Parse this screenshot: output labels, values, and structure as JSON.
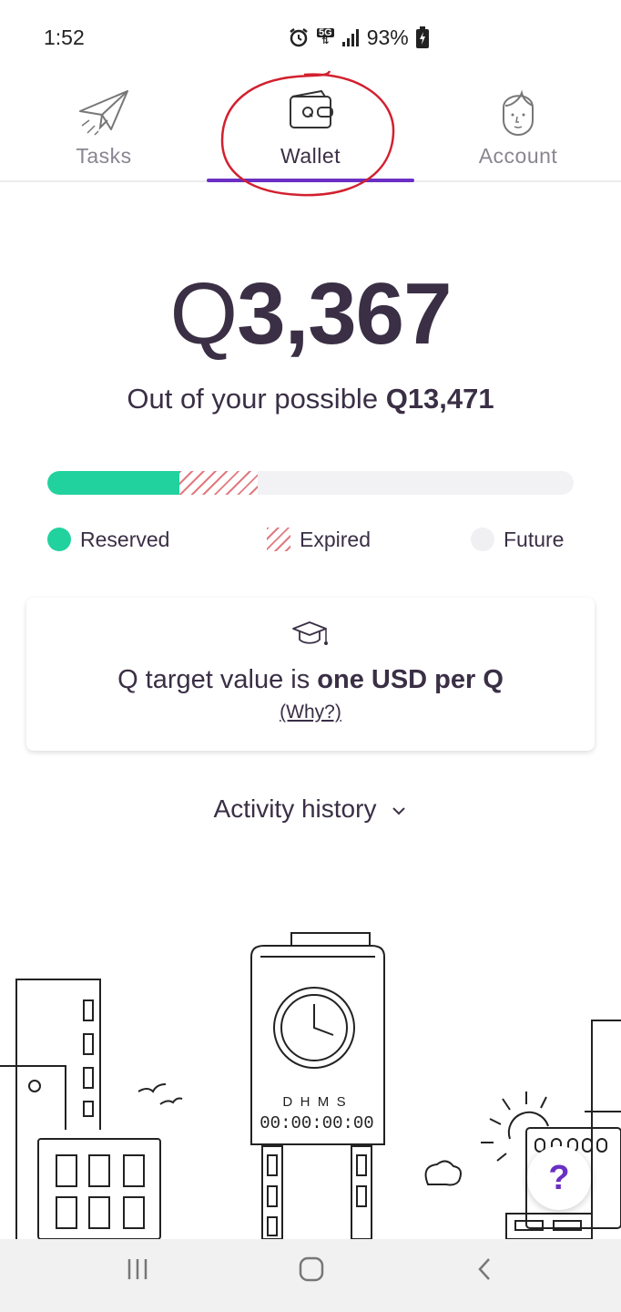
{
  "status_bar": {
    "time": "1:52",
    "network": "5G",
    "battery": "93%"
  },
  "tabs": [
    {
      "label": "Tasks",
      "icon": "paper-plane-icon"
    },
    {
      "label": "Wallet",
      "icon": "wallet-icon",
      "active": true
    },
    {
      "label": "Account",
      "icon": "person-face-icon"
    }
  ],
  "wallet": {
    "currency_symbol": "Q",
    "balance": "3,367",
    "possible_prefix": "Out of your possible ",
    "possible_symbol": "Q",
    "possible_value": "13,471",
    "progress": {
      "reserved_fraction": 0.25,
      "expired_fraction": 0.4
    },
    "legend": {
      "reserved": "Reserved",
      "expired": "Expired",
      "future": "Future"
    }
  },
  "info_card": {
    "icon": "graduation-cap-icon",
    "text_prefix": "Q target value is ",
    "text_bold": "one USD per Q",
    "link": "(Why?)"
  },
  "activity": {
    "label": "Activity history",
    "icon": "chevron-down-icon"
  },
  "illustration": {
    "clock_labels": "D  H  M  S",
    "countdown": "00:00:00:00"
  },
  "help_button": {
    "label": "?"
  },
  "colors": {
    "accent": "#6b2fc4",
    "reserved": "#21d29e",
    "expired": "#e27a80",
    "future": "#f0eff2",
    "text": "#3a2f45",
    "annotation": "#d2202f"
  }
}
